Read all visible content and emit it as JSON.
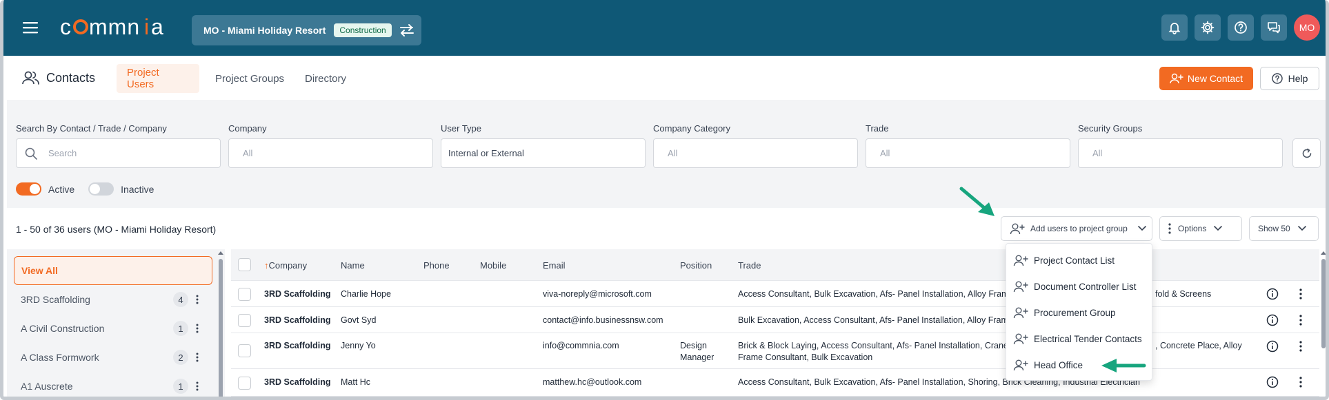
{
  "topbar": {
    "logo_text": "commnia",
    "project_name": "MO - Miami Holiday Resort",
    "project_status": "Construction",
    "avatar_initials": "MO",
    "accent": "#0f5876"
  },
  "nav": {
    "title": "Contacts",
    "tabs": [
      {
        "label": "Project Users",
        "active": true
      },
      {
        "label": "Project Groups",
        "active": false
      },
      {
        "label": "Directory",
        "active": false
      }
    ],
    "new_contact_label": "New Contact",
    "help_label": "Help"
  },
  "filters": {
    "search": {
      "label": "Search By Contact / Trade / Company",
      "placeholder": "Search"
    },
    "company": {
      "label": "Company",
      "placeholder": "All"
    },
    "user_type": {
      "label": "User Type",
      "value": "Internal or External"
    },
    "company_category": {
      "label": "Company Category",
      "placeholder": "All"
    },
    "trade": {
      "label": "Trade",
      "placeholder": "All"
    },
    "security_groups": {
      "label": "Security Groups",
      "placeholder": "All"
    },
    "active_label": "Active",
    "inactive_label": "Inactive",
    "active_on": true,
    "inactive_on": false
  },
  "results": {
    "count_text": "1 - 50 of 36 users (MO - Miami Holiday Resort)",
    "add_to_group_label": "Add users to project group",
    "options_label": "Options",
    "show_label": "Show 50"
  },
  "dropdown": {
    "items": [
      "Project Contact List",
      "Document Controller List",
      "Procurement Group",
      "Electrical Tender Contacts",
      "Head Office"
    ]
  },
  "sidebar": {
    "items": [
      {
        "label": "View All",
        "count": ""
      },
      {
        "label": "3RD Scaffolding",
        "count": "4"
      },
      {
        "label": "A Civil Construction",
        "count": "1"
      },
      {
        "label": "A Class Formwork",
        "count": "2"
      },
      {
        "label": "A1 Auscrete",
        "count": "1"
      }
    ]
  },
  "table": {
    "sort_arrow": "↑",
    "headers": {
      "company": "Company",
      "name": "Name",
      "phone": "Phone",
      "mobile": "Mobile",
      "email": "Email",
      "position": "Position",
      "trade": "Trade"
    },
    "rows": [
      {
        "company": "3RD Scaffolding",
        "name": "Charlie Hope",
        "phone": "",
        "mobile": "",
        "email": "viva-noreply@microsoft.com",
        "position": "",
        "trade": "Access Consultant, Bulk Excavation, Afs- Panel Installation, Alloy Frame",
        "trade2": "fold & Screens"
      },
      {
        "company": "3RD Scaffolding",
        "name": "Govt Syd",
        "phone": "",
        "mobile": "",
        "email": "contact@info.businessnsw.com",
        "position": "",
        "trade": "Bulk Excavation, Access Consultant, Afs- Panel Installation, Alloy Frame",
        "trade2": ""
      },
      {
        "company": "3RD Scaffolding",
        "name": "Jenny Yo",
        "phone": "",
        "mobile": "",
        "email": "info@commnia.com",
        "position": "Design Manager",
        "trade": "Brick & Block Laying, Access Consultant, Afs- Panel Installation, Crane",
        "trade2": ", Concrete Place, Alloy",
        "trade_line2": "Frame Consultant, Bulk Excavation"
      },
      {
        "company": "3RD Scaffolding",
        "name": "Matt Hc",
        "phone": "",
        "mobile": "",
        "email": "matthew.hc@outlook.com",
        "position": "",
        "trade": "Access Consultant, Bulk Excavation, Afs- Panel Installation, Shoring, Brick Cleaning, Industrial Electrician",
        "trade2": ""
      }
    ]
  },
  "colors": {
    "orange": "#f26a22",
    "teal_arrow": "#17a57e",
    "header": "#0f5876"
  }
}
